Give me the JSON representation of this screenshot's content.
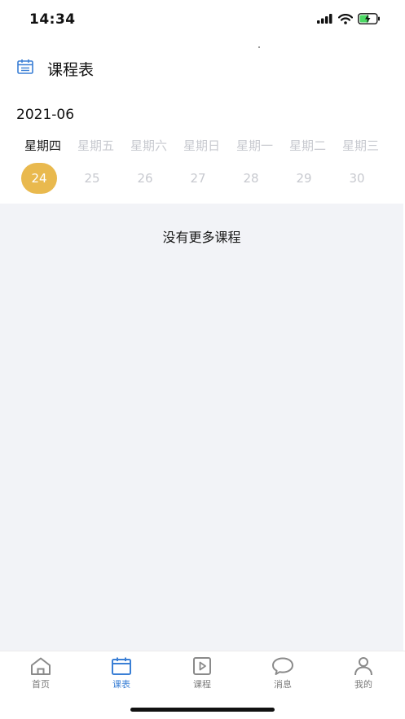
{
  "status_bar": {
    "time": "14:34"
  },
  "header": {
    "icon": "calendar-icon",
    "title": "课程表"
  },
  "schedule": {
    "month": "2021-06",
    "days": [
      {
        "weekday": "星期四",
        "date": "24",
        "selected": true
      },
      {
        "weekday": "星期五",
        "date": "25",
        "selected": false
      },
      {
        "weekday": "星期六",
        "date": "26",
        "selected": false
      },
      {
        "weekday": "星期日",
        "date": "27",
        "selected": false
      },
      {
        "weekday": "星期一",
        "date": "28",
        "selected": false
      },
      {
        "weekday": "星期二",
        "date": "29",
        "selected": false
      },
      {
        "weekday": "星期三",
        "date": "30",
        "selected": false
      }
    ],
    "empty_message": "没有更多课程"
  },
  "tabbar": {
    "tabs": [
      {
        "label": "首页",
        "icon": "home-icon",
        "active": false
      },
      {
        "label": "课表",
        "icon": "calendar-icon",
        "active": true
      },
      {
        "label": "课程",
        "icon": "video-icon",
        "active": false
      },
      {
        "label": "消息",
        "icon": "message-icon",
        "active": false
      },
      {
        "label": "我的",
        "icon": "profile-icon",
        "active": false
      }
    ]
  },
  "colors": {
    "accent": "#e9b94e",
    "active_tab": "#3a7fd5",
    "content_bg": "#f2f3f7"
  }
}
